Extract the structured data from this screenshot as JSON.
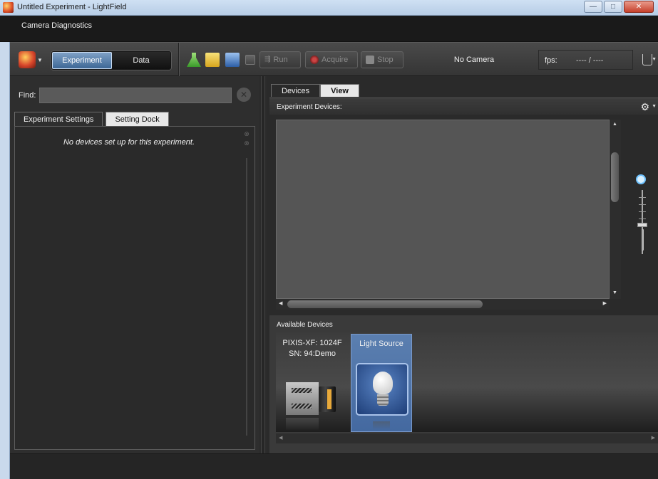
{
  "window": {
    "title": "Untitled Experiment - LightField",
    "minimize": "—",
    "maximize": "□",
    "close": "✕"
  },
  "menu": {
    "items": [
      "Camera Diagnostics"
    ]
  },
  "toolbar": {
    "mode_experiment": "Experiment",
    "mode_data": "Data",
    "run_label": "Run",
    "acquire_label": "Acquire",
    "stop_label": "Stop",
    "camera_status": "No Camera",
    "fps_label": "fps:",
    "fps_value": "---- / ----"
  },
  "left_panel": {
    "find_label": "Find:",
    "find_value": "",
    "tabs": [
      {
        "label": "Experiment Settings",
        "active": true
      },
      {
        "label": "Setting Dock",
        "active": false
      }
    ],
    "empty_message": "No devices set up for this experiment."
  },
  "right_panel": {
    "tabs": [
      {
        "label": "Devices",
        "active": true
      },
      {
        "label": "View",
        "active": false
      }
    ],
    "experiment_devices_label": "Experiment Devices:",
    "available_devices_label": "Available Devices",
    "available_devices": [
      {
        "name_line1": "PIXIS-XF: 1024F",
        "name_line2": "SN: 94:Demo",
        "icon": "camera-icon",
        "selected": false
      },
      {
        "name_line1": "Light Source",
        "name_line2": "",
        "icon": "light-bulb-icon",
        "selected": true
      }
    ]
  },
  "colors": {
    "accent": "#4a72a8",
    "background": "#2b2b2b",
    "titlebar": "#c4d7ee"
  }
}
